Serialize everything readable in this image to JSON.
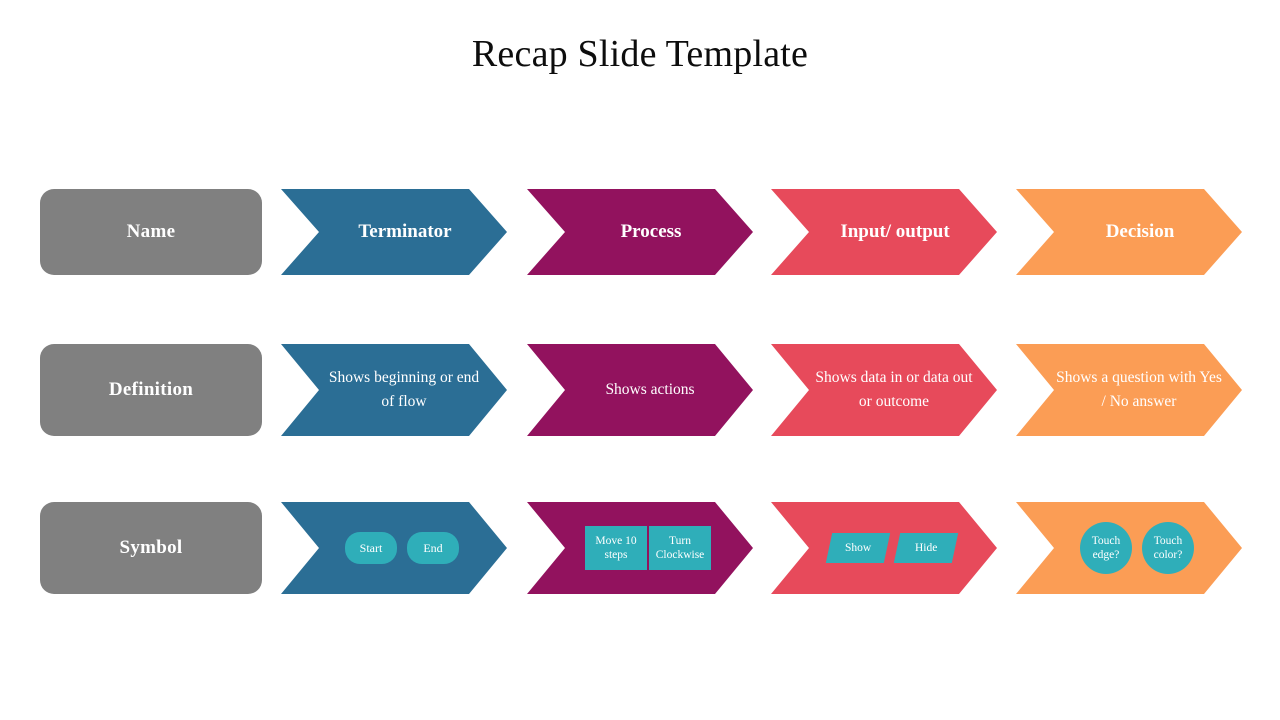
{
  "slide": {
    "title": "Recap Slide Template",
    "background": "#FFFFFF"
  },
  "colors": {
    "label_gray": "#808080",
    "terminator_blue": "#2B6E95",
    "process_magenta": "#92125E",
    "io_red": "#E74A5B",
    "decision_orange": "#FB9D55",
    "symbol_teal": "#2FAEB9",
    "text_white": "#FFFFFF",
    "title_black": "#0D0D0D"
  },
  "rows": {
    "name": {
      "label": "Name"
    },
    "definition": {
      "label": "Definition"
    },
    "symbol": {
      "label": "Symbol"
    }
  },
  "columns": [
    {
      "key": "terminator",
      "color": "#2B6E95",
      "name": "Terminator",
      "definition": "Shows beginning or end of flow",
      "symbol_shape": "pill",
      "symbols": [
        "Start",
        "End"
      ]
    },
    {
      "key": "process",
      "color": "#92125E",
      "name": "Process",
      "definition": "Shows actions",
      "symbol_shape": "rect",
      "symbols": [
        "Move 10 steps",
        "Turn Clockwise"
      ]
    },
    {
      "key": "input-output",
      "color": "#E74A5B",
      "name": "Input/ output",
      "definition": "Shows data in or data out or outcome",
      "symbol_shape": "parallelogram",
      "symbols": [
        "Show",
        "Hide"
      ]
    },
    {
      "key": "decision",
      "color": "#FB9D55",
      "name": "Decision",
      "definition": "Shows a question with Yes / No answer",
      "symbol_shape": "circle",
      "symbols": [
        "Touch edge?",
        "Touch color?"
      ]
    }
  ]
}
